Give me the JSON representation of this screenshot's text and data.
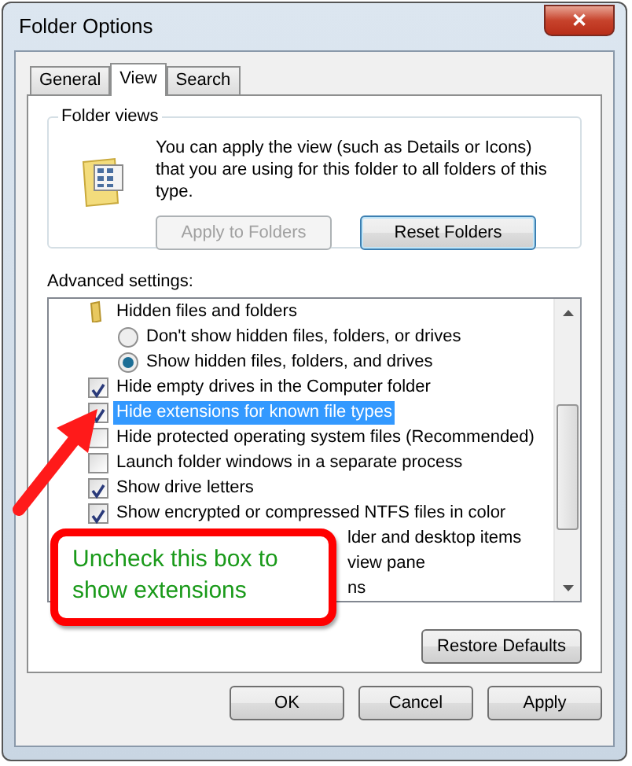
{
  "window": {
    "title": "Folder Options",
    "close": "✕"
  },
  "tabs": [
    {
      "label": "General",
      "selected": false
    },
    {
      "label": "View",
      "selected": true
    },
    {
      "label": "Search",
      "selected": false
    }
  ],
  "folder_views": {
    "legend": "Folder views",
    "description": "You can apply the view (such as Details or Icons) that you are using for this folder to all folders of this type.",
    "buttons": [
      {
        "label": "Apply to Folders",
        "disabled": true
      },
      {
        "label": "Reset Folders",
        "disabled": false
      }
    ]
  },
  "advanced": {
    "label": "Advanced settings:",
    "items": [
      {
        "kind": "folder",
        "text": "Hidden files and folders",
        "selected": false
      },
      {
        "kind": "radio",
        "text": "Don't show hidden files, folders, or drives",
        "checked": false,
        "selected": false
      },
      {
        "kind": "radio",
        "text": "Show hidden files, folders, and drives",
        "checked": true,
        "selected": false
      },
      {
        "kind": "checkbox",
        "text": "Hide empty drives in the Computer folder",
        "checked": true,
        "selected": false
      },
      {
        "kind": "checkbox",
        "text": "Hide extensions for known file types",
        "checked": true,
        "selected": true
      },
      {
        "kind": "checkbox",
        "text": "Hide protected operating system files (Recommended)",
        "checked": false,
        "selected": false
      },
      {
        "kind": "checkbox",
        "text": "Launch folder windows in a separate process",
        "checked": false,
        "selected": false
      },
      {
        "kind": "checkbox",
        "text": "Show drive letters",
        "checked": true,
        "selected": false
      },
      {
        "kind": "checkbox",
        "text": "Show encrypted or compressed NTFS files in color",
        "checked": true,
        "selected": false
      },
      {
        "kind": "covered",
        "text": "lder and desktop items",
        "selected": false
      },
      {
        "kind": "covered",
        "text": "view pane",
        "selected": false
      },
      {
        "kind": "covered",
        "text": "ns",
        "selected": false
      }
    ],
    "restore": "Restore Defaults"
  },
  "callout": {
    "text": "Uncheck this box to show extensions"
  },
  "buttons": [
    {
      "label": "OK"
    },
    {
      "label": "Cancel"
    },
    {
      "label": "Apply"
    }
  ]
}
